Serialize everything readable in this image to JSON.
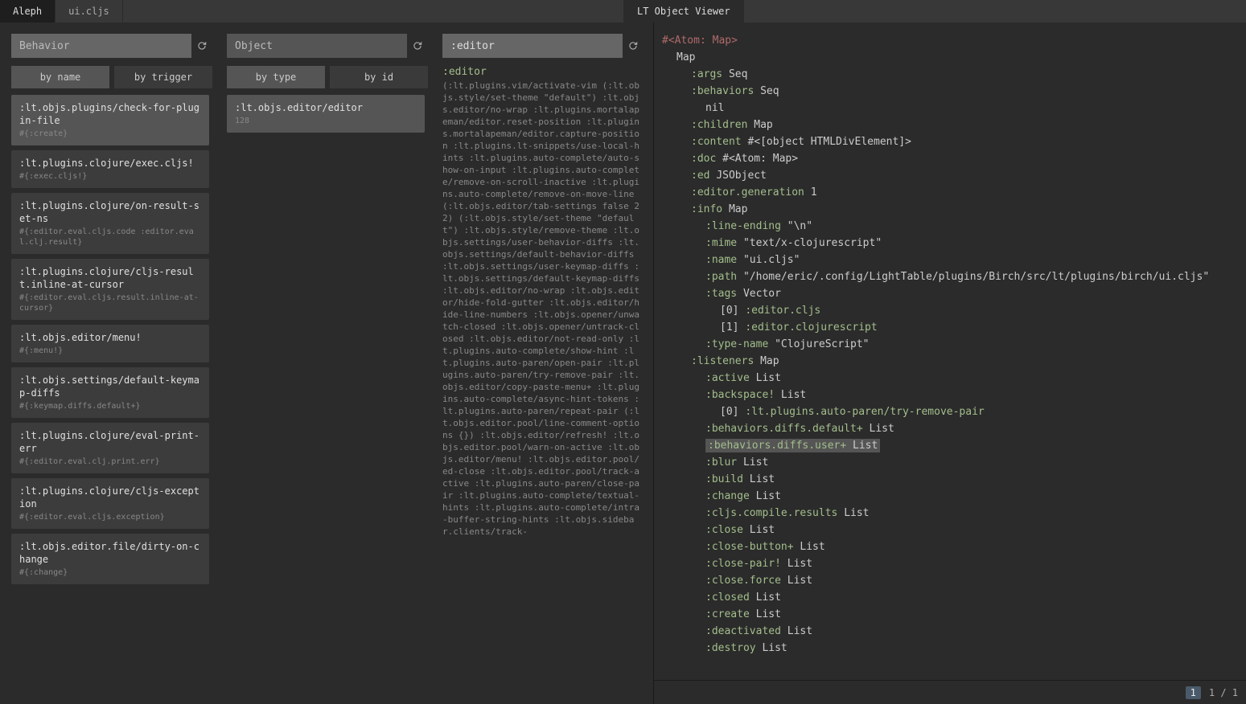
{
  "tabs": {
    "left1": "Aleph",
    "left2": "ui.cljs",
    "right1": "LT Object Viewer"
  },
  "col_behavior": {
    "placeholder": "Behavior",
    "btn_name": "by name",
    "btn_trigger": "by trigger",
    "items": [
      {
        "title": ":lt.objs.plugins/check-for-plugin-file",
        "sub": "#{:create}",
        "selected": true
      },
      {
        "title": ":lt.plugins.clojure/exec.cljs!",
        "sub": "#{:exec.cljs!}"
      },
      {
        "title": ":lt.plugins.clojure/on-result-set-ns",
        "sub": "#{:editor.eval.cljs.code :editor.eval.clj.result}"
      },
      {
        "title": ":lt.plugins.clojure/cljs-result.inline-at-cursor",
        "sub": "#{:editor.eval.cljs.result.inline-at-cursor}"
      },
      {
        "title": ":lt.objs.editor/menu!",
        "sub": "#{:menu!}"
      },
      {
        "title": ":lt.objs.settings/default-keymap-diffs",
        "sub": "#{:keymap.diffs.default+}"
      },
      {
        "title": ":lt.plugins.clojure/eval-print-err",
        "sub": "#{:editor.eval.clj.print.err}"
      },
      {
        "title": ":lt.plugins.clojure/cljs-exception",
        "sub": "#{:editor.eval.cljs.exception}"
      },
      {
        "title": ":lt.objs.editor.file/dirty-on-change",
        "sub": "#{:change}"
      }
    ]
  },
  "col_object": {
    "placeholder": "Object",
    "btn_type": "by type",
    "btn_id": "by id",
    "items": [
      {
        "title": ":lt.objs.editor/editor",
        "sub": "128",
        "selected": true
      }
    ]
  },
  "col_editor": {
    "value": ":editor",
    "title": ":editor",
    "body": "(:lt.plugins.vim/activate-vim (:lt.objs.style/set-theme \"default\") :lt.objs.editor/no-wrap :lt.plugins.mortalapeman/editor.reset-position :lt.plugins.mortalapeman/editor.capture-position :lt.plugins.lt-snippets/use-local-hints :lt.plugins.auto-complete/auto-show-on-input :lt.plugins.auto-complete/remove-on-scroll-inactive :lt.plugins.auto-complete/remove-on-move-line (:lt.objs.editor/tab-settings false 2 2) (:lt.objs.style/set-theme \"default\") :lt.objs.style/remove-theme :lt.objs.settings/user-behavior-diffs :lt.objs.settings/default-behavior-diffs :lt.objs.settings/user-keymap-diffs :lt.objs.settings/default-keymap-diffs :lt.objs.editor/no-wrap :lt.objs.editor/hide-fold-gutter :lt.objs.editor/hide-line-numbers :lt.objs.opener/unwatch-closed :lt.objs.opener/untrack-closed :lt.objs.editor/not-read-only :lt.plugins.auto-complete/show-hint :lt.plugins.auto-paren/open-pair :lt.plugins.auto-paren/try-remove-pair :lt.objs.editor/copy-paste-menu+ :lt.plugins.auto-complete/async-hint-tokens :lt.plugins.auto-paren/repeat-pair (:lt.objs.editor.pool/line-comment-options {}) :lt.objs.editor/refresh! :lt.objs.editor.pool/warn-on-active :lt.objs.editor/menu! :lt.objs.editor.pool/ed-close :lt.objs.editor.pool/track-active :lt.plugins.auto-paren/close-pair :lt.plugins.auto-complete/textual-hints :lt.plugins.auto-complete/intra-buffer-string-hints :lt.objs.sidebar.clients/track-"
  },
  "viewer": {
    "atom_header": "#<Atom: Map>",
    "root_type": "Map",
    "args_k": ":args",
    "args_v": "Seq",
    "behaviors_k": ":behaviors",
    "behaviors_v": "Seq",
    "nil_v": "nil",
    "children_k": ":children",
    "children_v": "Map",
    "content_k": ":content",
    "content_v": "#<[object HTMLDivElement]>",
    "doc_k": ":doc",
    "doc_v": "#<Atom: Map>",
    "ed_k": ":ed",
    "ed_v": "JSObject",
    "egen_k": ":editor.generation",
    "egen_v": "1",
    "info_k": ":info",
    "info_v": "Map",
    "lineend_k": ":line-ending",
    "lineend_v": "\"\\n\"",
    "mime_k": ":mime",
    "mime_v": "\"text/x-clojurescript\"",
    "name_k": ":name",
    "name_v": "\"ui.cljs\"",
    "path_k": ":path",
    "path_v": "\"/home/eric/.config/LightTable/plugins/Birch/src/lt/plugins/birch/ui.cljs\"",
    "tags_k": ":tags",
    "tags_v": "Vector",
    "tag0_i": "[0]",
    "tag0_v": ":editor.cljs",
    "tag1_i": "[1]",
    "tag1_v": ":editor.clojurescript",
    "typename_k": ":type-name",
    "typename_v": "\"ClojureScript\"",
    "listeners_k": ":listeners",
    "listeners_v": "Map",
    "active_k": ":active",
    "active_v": "List",
    "backspace_k": ":backspace!",
    "backspace_v": "List",
    "bs0_i": "[0]",
    "bs0_v": ":lt.plugins.auto-paren/try-remove-pair",
    "bdd_k": ":behaviors.diffs.default+",
    "bdd_v": "List",
    "bdu_k": ":behaviors.diffs.user+",
    "bdu_v": "List",
    "blur_k": ":blur",
    "blur_v": "List",
    "build_k": ":build",
    "build_v": "List",
    "change_k": ":change",
    "change_v": "List",
    "cljs_k": ":cljs.compile.results",
    "cljs_v": "List",
    "close_k": ":close",
    "close_v": "List",
    "closebtn_k": ":close-button+",
    "closebtn_v": "List",
    "closepair_k": ":close-pair!",
    "closepair_v": "List",
    "closeforce_k": ":close.force",
    "closeforce_v": "List",
    "closed_k": ":closed",
    "closed_v": "List",
    "create_k": ":create",
    "create_v": "List",
    "deact_k": ":deactivated",
    "deact_v": "List",
    "destroy_k": ":destroy",
    "destroy_v": "List"
  },
  "footer": {
    "page": "1",
    "pagetext": "1 / 1"
  }
}
